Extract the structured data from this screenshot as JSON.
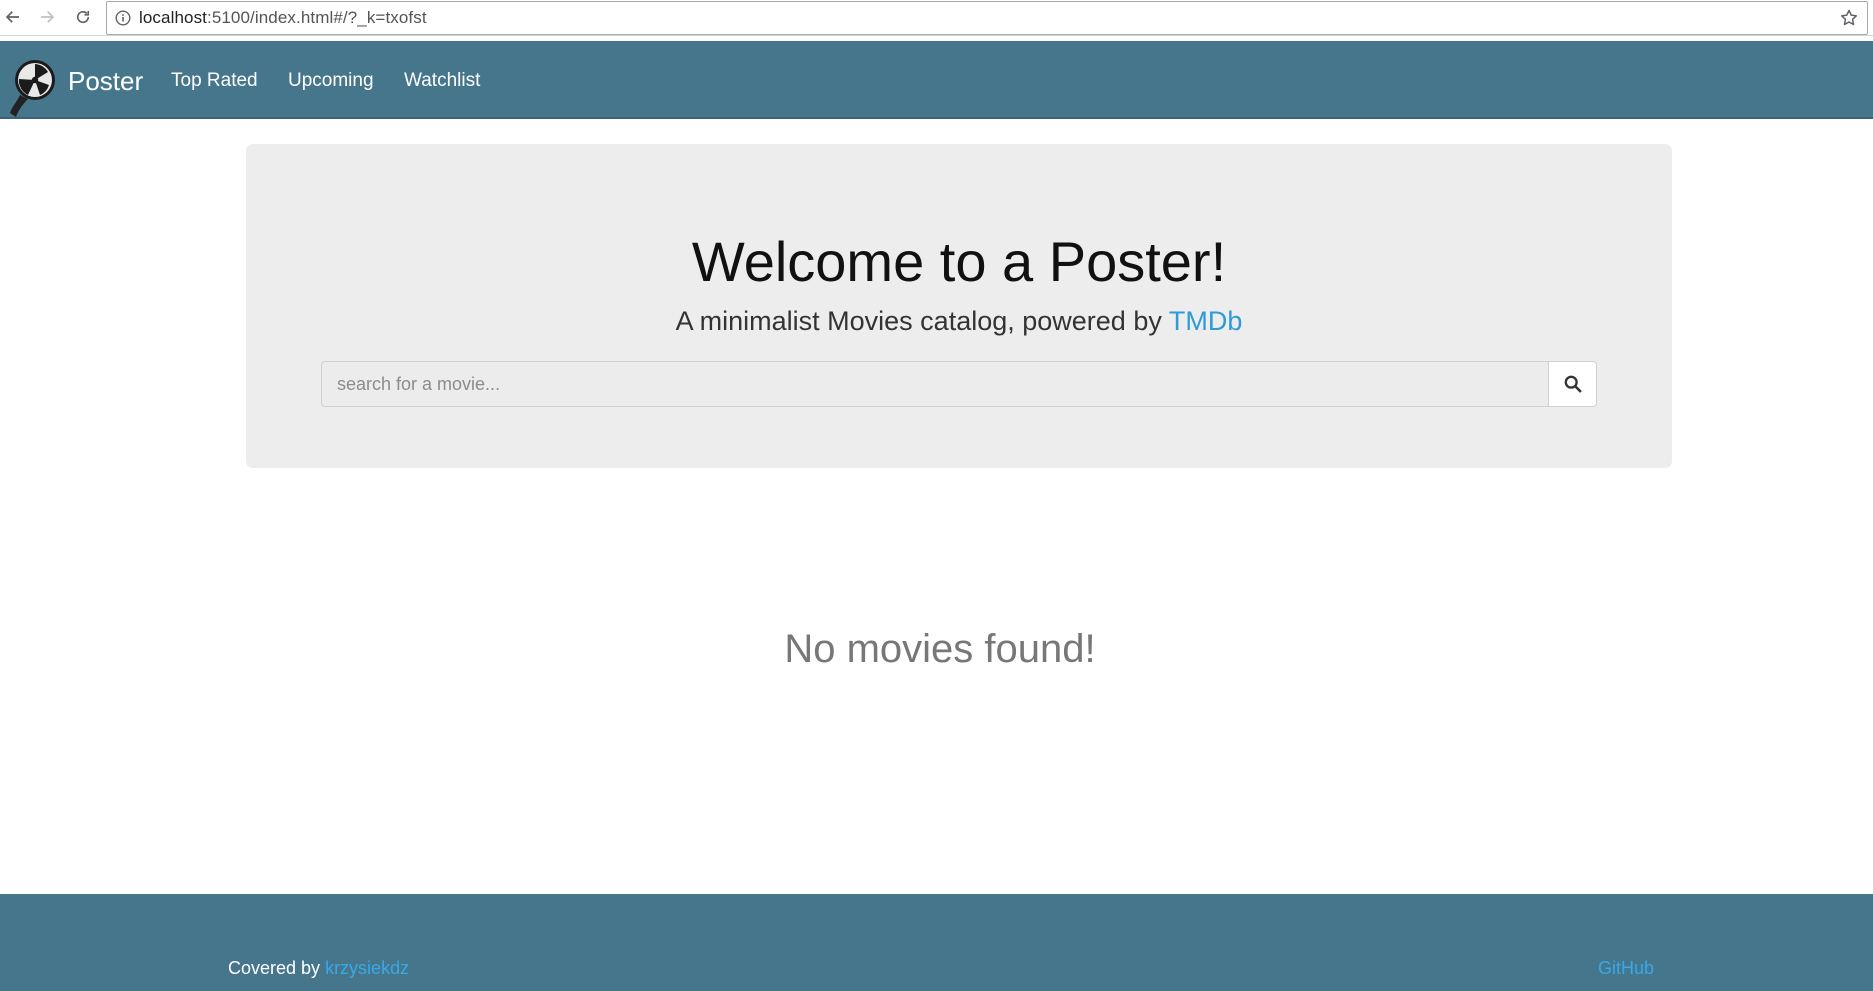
{
  "browser": {
    "url_host": "localhost",
    "url_rest": ":5100/index.html#/?_k=txofst"
  },
  "navbar": {
    "brand": "Poster",
    "links": [
      {
        "label": "Top Rated"
      },
      {
        "label": "Upcoming"
      },
      {
        "label": "Watchlist"
      }
    ]
  },
  "hero": {
    "title": "Welcome to a Poster!",
    "subtitle_prefix": "A minimalist Movies catalog, powered by ",
    "subtitle_link": "TMDb",
    "search_placeholder": "search for a movie...",
    "search_value": ""
  },
  "results": {
    "empty_message": "No movies found!"
  },
  "footer": {
    "credit_prefix": "Covered by ",
    "credit_link": "krzysiekdz",
    "github": "GitHub"
  },
  "colors": {
    "navbar": "#46768c",
    "link": "#2d9bd9",
    "jumbotron": "#ededed"
  },
  "icons": {
    "back": "back-arrow-icon",
    "forward": "forward-arrow-icon",
    "reload": "reload-icon",
    "info": "info-icon",
    "bookmark": "star-icon",
    "logo": "film-reel-logo",
    "search": "search-icon"
  }
}
